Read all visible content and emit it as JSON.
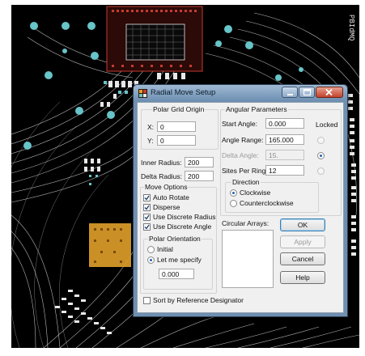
{
  "dialog": {
    "title": "Radial Move Setup",
    "polar_grid_origin": {
      "label": "Polar Grid Origin",
      "x_label": "X:",
      "x_value": "0",
      "y_label": "Y:",
      "y_value": "0"
    },
    "inner_radius": {
      "label": "Inner Radius:",
      "value": "200"
    },
    "delta_radius": {
      "label": "Delta Radius:",
      "value": "200"
    },
    "move_options": {
      "label": "Move Options",
      "items": [
        {
          "label": "Auto Rotate",
          "checked": true
        },
        {
          "label": "Disperse",
          "checked": true
        },
        {
          "label": "Use Discrete Radius",
          "checked": true
        },
        {
          "label": "Use Discrete Angle",
          "checked": true
        }
      ]
    },
    "polar_orientation": {
      "label": "Polar Orientation",
      "initial_label": "Initial",
      "let_me_specify_label": "Let me specify",
      "selected": "let_me_specify",
      "value": "0.000"
    },
    "angular_parameters": {
      "label": "Angular Parameters",
      "locked_label": "Locked",
      "start_angle": {
        "label": "Start Angle:",
        "value": "0.000"
      },
      "angle_range": {
        "label": "Angle Range:",
        "value": "165.000"
      },
      "delta_angle": {
        "label": "Delta Angle:",
        "value": "15."
      },
      "sites_per_ring": {
        "label": "Sites Per Ring:",
        "value": "12"
      },
      "locked_selected": "delta_angle"
    },
    "direction": {
      "label": "Direction",
      "clockwise_label": "Clockwise",
      "counterclockwise_label": "Counterclockwise",
      "selected": "clockwise"
    },
    "circular_arrays": {
      "label": "Circular Arrays:"
    },
    "buttons": {
      "ok": "OK",
      "apply": "Apply",
      "cancel": "Cancel",
      "help": "Help"
    },
    "sort_by_ref_des": {
      "label": "Sort by Reference Designator",
      "checked": false
    }
  },
  "background": {
    "board_text": "PBIdMQ"
  },
  "colors": {
    "pcb_background": "#000000",
    "trace_white": "#e8e8e8",
    "pad_cyan": "#67c4c8",
    "component_red": "#c63a2e",
    "pad_orange": "#e0a02a",
    "title_bar": "#7f9fc0",
    "dialog_face": "#f0f0f0",
    "close_button": "#c9452e"
  }
}
